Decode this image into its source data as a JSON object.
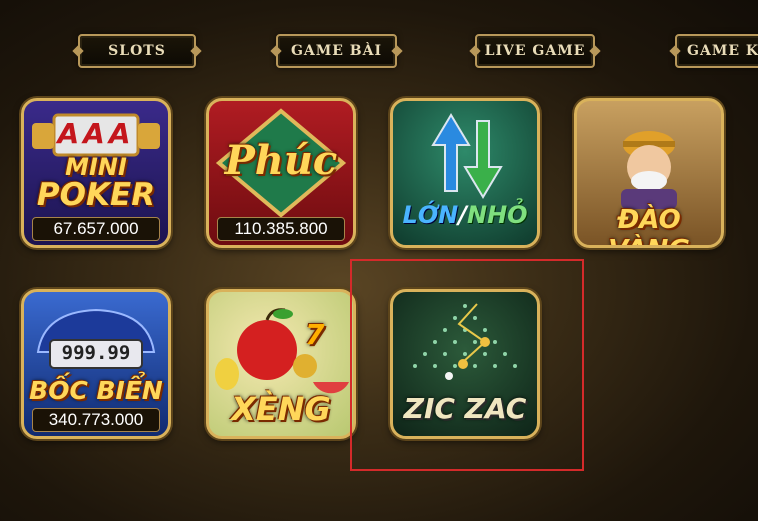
{
  "tabs": [
    "SLOTS",
    "GAME BÀI",
    "LIVE GAME",
    "GAME KH"
  ],
  "games": [
    {
      "title_line1": "MINI",
      "title_line2": "POKER",
      "reels": "AAA",
      "jackpot": "67.657.000"
    },
    {
      "title": "Phúc",
      "jackpot": "110.385.800"
    },
    {
      "title_left": "LỚN",
      "title_right": "NHỎ"
    },
    {
      "title": "ĐÀO VÀNG"
    },
    {
      "title": "BỐC BIỂN",
      "plate": "999.99",
      "jackpot": "340.773.000"
    },
    {
      "title": "XÈNG",
      "seven": "7"
    },
    {
      "title": "ZIC ZAC"
    }
  ],
  "colors": {
    "card_border": "#d9b25b",
    "title": "#ffd75a",
    "selection": "#d42a2a"
  },
  "selected_game": "ZIC ZAC"
}
